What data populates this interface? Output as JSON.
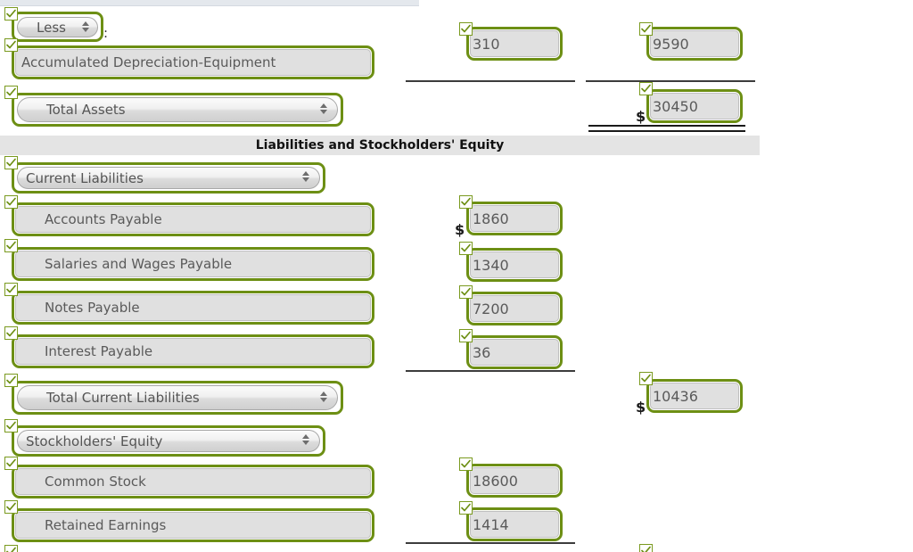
{
  "document": {
    "type": "balance-sheet-worksheet",
    "section_banner": "Liabilities and Stockholders' Equity"
  },
  "colors": {
    "validation_ring": "#6d8f14",
    "checkbox_border": "#7a9a1f",
    "input_fill": "#e0e0e0",
    "banner_fill": "#e4e4e4",
    "rule": "#3c3c3c"
  },
  "assets_section": {
    "less_select": "Less",
    "less_colon": ":",
    "accumulated_depreciation_label": "Accumulated Depreciation-Equipment",
    "accumulated_depreciation_amount": "310",
    "equipment_net_amount": "9590",
    "total_assets_select": "Total Assets",
    "total_assets_amount": "30450",
    "total_assets_currency": "$"
  },
  "liabilities_section": {
    "current_liabilities_select": "Current Liabilities",
    "rows": [
      {
        "label": "Accounts Payable",
        "amount": "1860",
        "currency": "$"
      },
      {
        "label": "Salaries and Wages Payable",
        "amount": "1340",
        "currency": ""
      },
      {
        "label": "Notes Payable",
        "amount": "7200",
        "currency": ""
      },
      {
        "label": "Interest Payable",
        "amount": "36",
        "currency": ""
      }
    ],
    "total_current_liabilities_select": "Total Current Liabilities",
    "total_current_liabilities_amount": "10436",
    "total_current_liabilities_currency": "$"
  },
  "equity_section": {
    "stockholders_equity_select": "Stockholders' Equity",
    "rows": [
      {
        "label": "Common Stock",
        "amount": "18600"
      },
      {
        "label": "Retained Earnings",
        "amount": "1414"
      }
    ]
  },
  "icons": {
    "checkmark": "check-icon",
    "select_arrows": "stepper-arrows-icon"
  }
}
